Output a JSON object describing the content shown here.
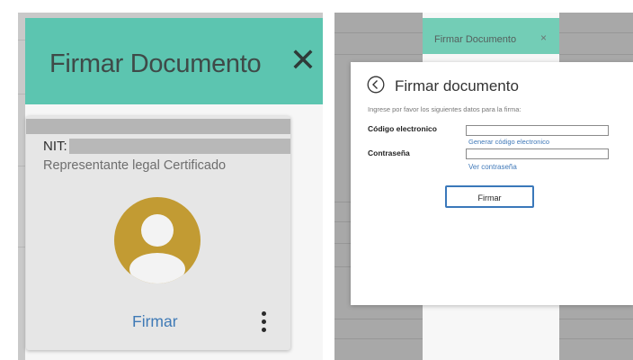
{
  "left_panel": {
    "title": "Firmar Documento",
    "close_icon": "close-icon",
    "card": {
      "nit_label": "NIT:",
      "subtitle": "Representante legal Certificado",
      "avatar_icon": "user-avatar-icon",
      "avatar_color": "#c29b33",
      "sign_label": "Firmar",
      "menu_icon": "more-vert-icon"
    },
    "header_color": "#5cc5b0"
  },
  "right_panel": {
    "tab": {
      "title": "Firmar Documento",
      "close_glyph": "×"
    },
    "dialog": {
      "back_icon": "circle-back-arrow-icon",
      "title": "Firmar documento",
      "instructions": "Ingrese por favor los siguientes datos para la firma:",
      "code_label": "Código electronico",
      "code_value": "",
      "generate_link": "Generar código electronico",
      "password_label": "Contraseña",
      "password_value": "",
      "show_password_link": "Ver contraseña",
      "submit_label": "Firmar"
    },
    "link_color": "#3f78b8",
    "button_border_color": "#3a78ba"
  }
}
